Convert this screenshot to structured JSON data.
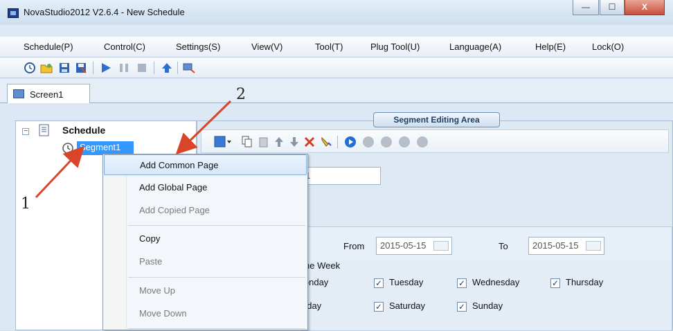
{
  "window": {
    "title": "NovaStudio2012 V2.6.4 - New Schedule",
    "min_glyph": "—",
    "max_glyph": "☐",
    "close_glyph": "X"
  },
  "menu": [
    "Schedule(P)",
    "Control(C)",
    "Settings(S)",
    "View(V)",
    "Tool(T)",
    "Plug Tool(U)",
    "Language(A)",
    "Help(E)",
    "Lock(O)"
  ],
  "toolbar_icons": [
    "clock-icon",
    "open-folder-icon",
    "save-icon",
    "save-as-icon",
    "play-icon",
    "pause-icon",
    "stop-icon",
    "upload-arrow-icon",
    "send-screen-icon"
  ],
  "tab": {
    "label": "Screen1"
  },
  "tree": {
    "root": "Schedule",
    "child": "Segment1"
  },
  "segment_area": {
    "title": "Segment Editing Area",
    "name_value": "1",
    "from_label": "From",
    "from_date": "2015-05-15",
    "to_label": "To",
    "to_date": "2015-05-15",
    "week_label": "he Week",
    "days": [
      {
        "label": "londay",
        "checked": true
      },
      {
        "label": "Tuesday",
        "checked": true
      },
      {
        "label": "Wednesday",
        "checked": true
      },
      {
        "label": "Thursday",
        "checked": true
      },
      {
        "label": "riday",
        "checked": true
      },
      {
        "label": "Saturday",
        "checked": true
      },
      {
        "label": "Sunday",
        "checked": true
      }
    ]
  },
  "context_menu": {
    "items": [
      {
        "label": "Add Common Page",
        "enabled": true,
        "highlighted": true
      },
      {
        "label": "Add Global Page",
        "enabled": true
      },
      {
        "label": "Add Copied Page",
        "enabled": false
      },
      {
        "label": "Copy",
        "enabled": true
      },
      {
        "label": "Paste",
        "enabled": false
      },
      {
        "label": "Move Up",
        "enabled": false
      },
      {
        "label": "Move Down",
        "enabled": false
      }
    ]
  },
  "annotations": {
    "step1": "1",
    "step2": "2",
    "arrow_color": "#d9452b"
  },
  "colors": {
    "accent": "#3399ff",
    "highlight_border": "#84acd8"
  }
}
